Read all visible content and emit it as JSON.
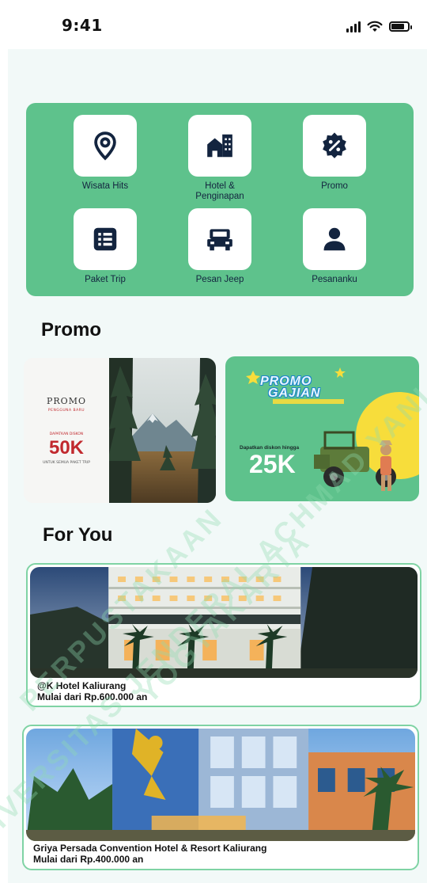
{
  "status_bar": {
    "time": "9:41",
    "icons": [
      "cellular-signal-icon",
      "wifi-icon",
      "battery-icon"
    ]
  },
  "menu": {
    "background_color": "#5ec28c",
    "icon_color": "#13243f",
    "items": [
      {
        "label": "Wisata Hits",
        "icon": "map-pin-icon"
      },
      {
        "label": "Hotel & Penginapan",
        "icon": "building-icon"
      },
      {
        "label": "Promo",
        "icon": "discount-badge-icon"
      },
      {
        "label": "Paket Trip",
        "icon": "list-icon"
      },
      {
        "label": "Pesan Jeep",
        "icon": "jeep-icon"
      },
      {
        "label": "Pesananku",
        "icon": "user-icon"
      }
    ]
  },
  "promo_section": {
    "title": "Promo",
    "banners": [
      {
        "title": "PROMO",
        "subtitle": "PENGGUNA BARU",
        "line": "DAPATKAN DISKON",
        "value": "50K",
        "note": "UNTUK SEMUA PAKET TRIP"
      },
      {
        "title_line1": "PROMO",
        "title_line2": "GAJIAN",
        "subtitle": "Dapatkan diskon hingga",
        "value": "25K"
      }
    ]
  },
  "for_you_section": {
    "title": "For You",
    "cards": [
      {
        "name": "@K Hotel Kaliurang",
        "price": "Mulai dari Rp.600.000 an"
      },
      {
        "name": "Griya Persada Convention Hotel & Resort Kaliurang",
        "price": "Mulai dari Rp.400.000 an"
      }
    ]
  },
  "watermark": {
    "lines": [
      "PERPUSTAKAAN",
      "UNIVERSITAS JENDERAL ACHMAD YANI",
      "YOGYAKARTA"
    ]
  }
}
